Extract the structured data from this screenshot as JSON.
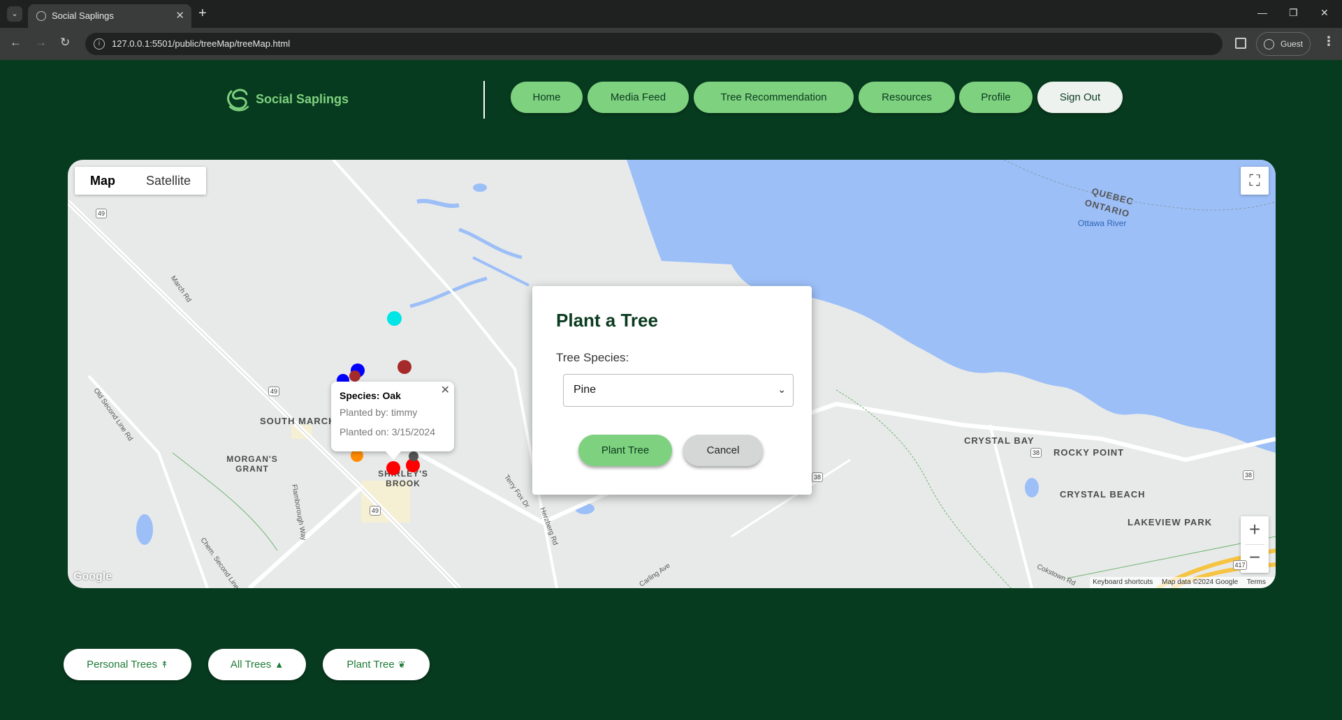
{
  "browser": {
    "tab_title": "Social Saplings",
    "url": "127.0.0.1:5501/public/treeMap/treeMap.html",
    "profile_label": "Guest"
  },
  "site": {
    "brand": "Social Saplings",
    "nav": [
      "Home",
      "Media Feed",
      "Tree Recommendation",
      "Resources",
      "Profile",
      "Sign Out"
    ]
  },
  "map": {
    "type_buttons": [
      "Map",
      "Satellite"
    ],
    "active_type": "Map",
    "places": [
      "SOUTH MARCH",
      "MORGAN'S GRANT",
      "SHIRLEY'S BROOK",
      "CRYSTAL BAY",
      "ROCKY POINT",
      "CRYSTAL BEACH",
      "LAKEVIEW PARK"
    ],
    "regions": [
      "QUEBEC",
      "ONTARIO"
    ],
    "water": "Ottawa River",
    "roads": [
      "March Rd",
      "Old Second Line Rd",
      "Flamborough Way",
      "Terry Fox Dr",
      "Herzberg Rd",
      "Carling Ave",
      "Cokstown Rd",
      "Chem. Second Line Rd"
    ],
    "highway_shields": [
      "49",
      "49",
      "49",
      "38",
      "38",
      "38",
      "417"
    ],
    "markers": [
      {
        "color": "#00e5e5"
      },
      {
        "color": "#a52a2a"
      },
      {
        "color": "#0000ff"
      },
      {
        "color": "#0000ff"
      },
      {
        "color": "#a52a2a"
      },
      {
        "color": "#ff8c00"
      },
      {
        "color": "#ff0000"
      },
      {
        "color": "#ff0000"
      },
      {
        "color": "#555555"
      }
    ],
    "google_logo": "Google",
    "attribution": [
      "Keyboard shortcuts",
      "Map data ©2024 Google",
      "Terms"
    ]
  },
  "info_window": {
    "species": "Species: Oak",
    "planted_by": "Planted by: timmy",
    "planted_on": "Planted on: 3/15/2024"
  },
  "modal": {
    "title": "Plant a Tree",
    "species_label": "Tree Species:",
    "species_value": "Pine",
    "plant_label": "Plant Tree",
    "cancel_label": "Cancel"
  },
  "bottom": {
    "personal": "Personal Trees",
    "all": "All Trees",
    "plant": "Plant Tree"
  },
  "icons": {
    "personal": "tree-icon",
    "all": "evergreen-icon",
    "plant": "leaf-icon"
  }
}
